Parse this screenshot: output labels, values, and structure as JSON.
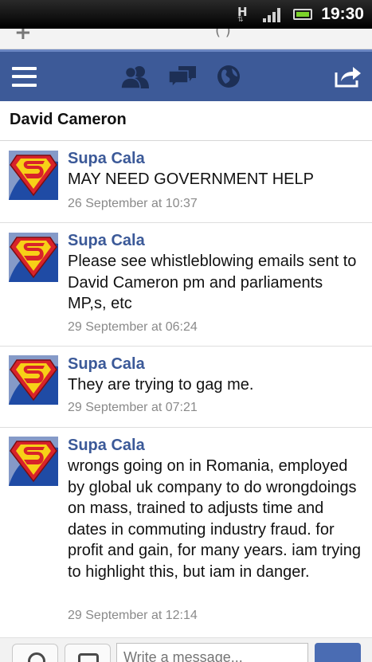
{
  "status_bar": {
    "network": "H",
    "time": "19:30"
  },
  "navbar": {
    "icons": [
      "menu-icon",
      "friends-icon",
      "messages-icon",
      "globe-icon",
      "share-icon"
    ],
    "color": "#3d5a98"
  },
  "conversation": {
    "title": "David Cameron"
  },
  "messages": [
    {
      "sender": "Supa Cala",
      "text": "MAY NEED GOVERNMENT HELP",
      "time": "26 September at 10:37"
    },
    {
      "sender": "Supa Cala",
      "text": "Please see whistleblowing emails sent to David Cameron pm and parliaments MP,s, etc",
      "time": "29 September at 06:24"
    },
    {
      "sender": "Supa Cala",
      "text": "They are trying to gag me.",
      "time": "29 September at 07:21"
    },
    {
      "sender": "Supa Cala",
      "text": "wrongs going on in Romania, employed by global uk company to do wrongdoings on mass, trained to adjusts time and dates in commuting industry fraud. for profit and gain, for many years. iam trying to highlight this, but iam in danger.",
      "time": "29 September at 12:14"
    }
  ],
  "composer": {
    "placeholder": "Write a message..."
  },
  "colors": {
    "sender": "#3b5998",
    "timestamp": "#8a8a8a",
    "avatar_red": "#d8232a",
    "avatar_yellow": "#f7d117",
    "avatar_blue": "#1f4ba5"
  }
}
